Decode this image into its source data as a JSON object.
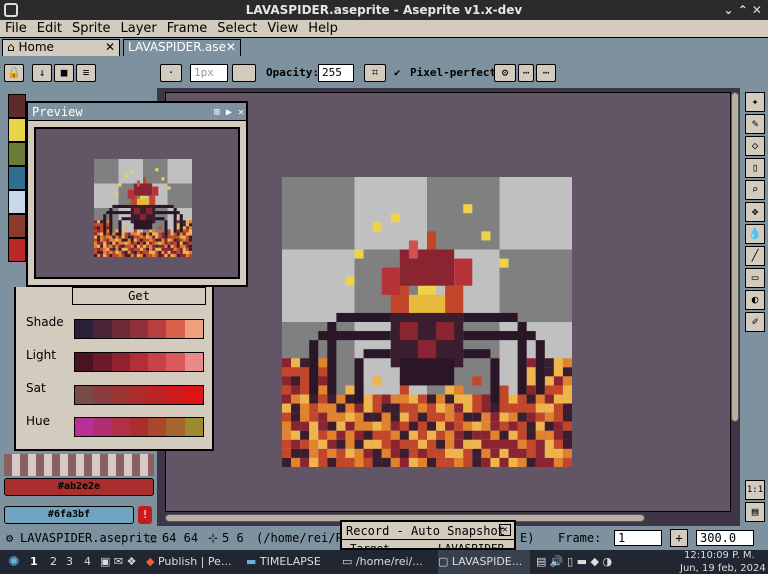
{
  "window": {
    "title": "LAVASPIDER.aseprite - Aseprite v1.x-dev",
    "controls": "⌄ ⌃ ✕"
  },
  "menu": [
    "File",
    "Edit",
    "Sprite",
    "Layer",
    "Frame",
    "Select",
    "View",
    "Help"
  ],
  "tabs": [
    {
      "label": "Home",
      "close": "✕"
    },
    {
      "label": "LAVASPIDER.ase",
      "close": "✕"
    }
  ],
  "toolbar": {
    "size_label": "1px",
    "opacity_label": "Opacity:",
    "opacity_value": "255",
    "pixel_perfect_label": "Pixel-perfect",
    "pixel_perfect_check": "✔",
    "buttons": [
      "🔒",
      "↓",
      "■",
      "≡",
      "·",
      "⌗",
      "⚙",
      "⋯"
    ]
  },
  "preview": {
    "title": "Preview",
    "buttons": [
      "⊞",
      "▶",
      "✕"
    ]
  },
  "color_panel": {
    "get_label": "Get",
    "shade_label": "Shade",
    "light_label": "Light",
    "sat_label": "Sat",
    "hue_label": "Hue",
    "shade_colors": [
      "#2b1e37",
      "#4a2436",
      "#6e2a35",
      "#91303a",
      "#b83f3f",
      "#d9604a",
      "#f0a07e"
    ],
    "light_colors": [
      "#4a1320",
      "#6b1a28",
      "#8f2330",
      "#b12f38",
      "#c84248",
      "#da5a5c",
      "#e88a88"
    ],
    "sat_colors": [
      "#7a4a48",
      "#8c3c3c",
      "#9c3434",
      "#ac2c2c",
      "#bc2424",
      "#cc1c1c",
      "#dc1414"
    ],
    "hue_colors": [
      "#b83096",
      "#b22e74",
      "#b03046",
      "#ab2e2e",
      "#a8482e",
      "#a4662e",
      "#9e8a2e"
    ]
  },
  "palette": [
    "#5f2a2a",
    "#e8d44a",
    "#6b7b3a",
    "#2f6f8f",
    "#c8d8e8",
    "#8a3a2a",
    "#b82828"
  ],
  "fg_color": {
    "label": "#ab2e2e",
    "color": "#ab2e2e"
  },
  "bg_color": {
    "label": "#6fa3bf",
    "color": "#6fa3bf"
  },
  "statusbar": {
    "filename": "LAVASPIDER.aseprite",
    "size_text": "64 64",
    "pos_text": "5 6",
    "path_text": "(/home/rei/P",
    "path_end": "E)",
    "frame_label": "Frame:",
    "frame_value": "1",
    "zoom_value": "300.0"
  },
  "record": {
    "title": "Record - Auto Snapshot",
    "row_label": "Target",
    "row_value": "LAVASPIDER"
  },
  "right_tools": [
    "✦",
    "✎",
    "◇",
    "▯",
    "⌕",
    "✥",
    "💧",
    "╱",
    "▭",
    "◐",
    "✐"
  ],
  "right_bottom": [
    "1:1",
    "▤"
  ],
  "taskbar": {
    "workspaces": [
      "1",
      "2",
      "3",
      "4"
    ],
    "tasks": [
      "Publish | Pe...",
      "TIMELAPSE",
      "/home/rei/...",
      "LAVASPIDE..."
    ],
    "clock_time": "12:10:09 P. M.",
    "clock_date": "Jun, 19 feb, 2024"
  }
}
